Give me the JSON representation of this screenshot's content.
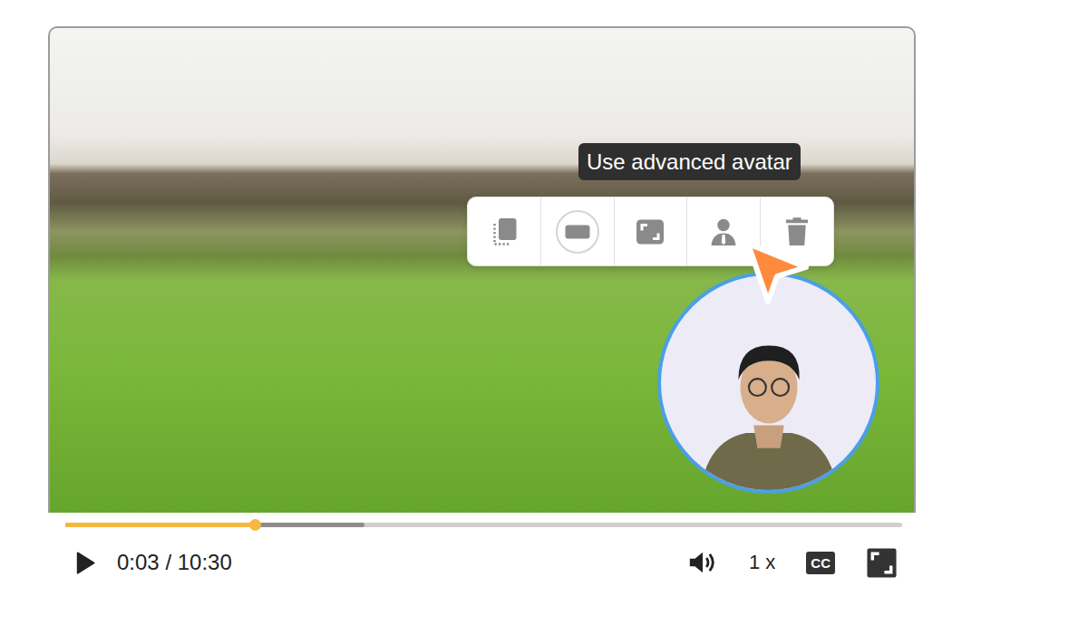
{
  "video": {
    "tooltip": "Use advanced avatar",
    "toolbar": [
      {
        "kind": "duplicate",
        "selected": false
      },
      {
        "kind": "background",
        "selected": true
      },
      {
        "kind": "resize",
        "selected": false
      },
      {
        "kind": "avatar",
        "selected": false
      },
      {
        "kind": "delete",
        "selected": false
      }
    ]
  },
  "player": {
    "playing": false,
    "time": "0:03 / 10:30",
    "speed": "1 x",
    "cc": "CC",
    "progress": {
      "level": 0.226
    },
    "buffered": {
      "level": 0.358
    }
  }
}
